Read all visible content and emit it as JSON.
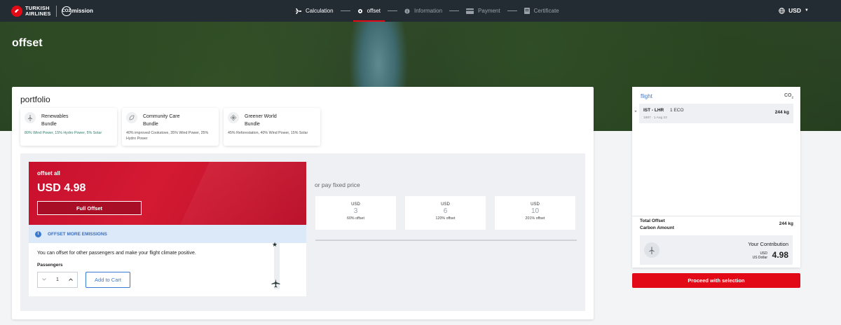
{
  "header": {
    "brand": "TURKISH AIRLINES",
    "brand_line1": "TURKISH",
    "brand_line2": "AIRLINES",
    "program_badge": "CO2",
    "program": "mission",
    "steps": [
      {
        "label": "Calculation",
        "icon": "plane-icon",
        "state": "done"
      },
      {
        "label": "offset",
        "icon": "gear-icon",
        "state": "active"
      },
      {
        "label": "Information",
        "icon": "info-icon",
        "state": "pending"
      },
      {
        "label": "Payment",
        "icon": "card-icon",
        "state": "pending"
      },
      {
        "label": "Certificate",
        "icon": "certificate-icon",
        "state": "pending"
      }
    ],
    "currency": "USD"
  },
  "hero": {
    "title": "offset"
  },
  "portfolio": {
    "title": "portfolio",
    "bundles": [
      {
        "name_line1": "Renewables",
        "name_line2": "Bundle",
        "description": "80% Wind Power, 15% Hydro Power, 5% Solar",
        "selected": true
      },
      {
        "name_line1": "Community Care",
        "name_line2": "Bundle",
        "description": "40% improved Cookstove, 35% Wind Power, 25% Hydro Power",
        "selected": false
      },
      {
        "name_line1": "Greener World",
        "name_line2": "Bundle",
        "description": "45% Reforestation, 40% Wind Power, 15% Solar",
        "selected": false
      }
    ]
  },
  "offset": {
    "label": "offset all",
    "price": "USD 4.98",
    "full_button": "Full Offset",
    "more_title": "OFFSET MORE EMISSIONS",
    "more_text": "You can offset for other passengers and make your flight climate positive.",
    "passengers_label": "Passengers",
    "passengers_value": "1",
    "add_to_cart": "Add to Cart"
  },
  "fixed": {
    "title": "or pay fixed price",
    "options": [
      {
        "currency": "USD",
        "amount": "3",
        "percent": "60% offset"
      },
      {
        "currency": "USD",
        "amount": "6",
        "percent": "120% offset"
      },
      {
        "currency": "USD",
        "amount": "10",
        "percent": "201% offset"
      }
    ]
  },
  "summary": {
    "flight_label": "flight",
    "co2_label": "CO",
    "co2_sub": "2",
    "remove_icon": "×",
    "route": "IST - LHR",
    "cabin": "1 ECO",
    "meta": "1987 · 1 Aug 22",
    "flight_kg": "244 kg",
    "total_line1": "Total Offset",
    "total_line2": "Carbon Amount",
    "total_kg": "244 kg",
    "contribution_label": "Your Contribution",
    "contribution_cur": "USD",
    "contribution_cur_long": "US Dollar",
    "contribution_amount": "4.98"
  },
  "proceed_button": "Proceed with selection",
  "colors": {
    "brand_red": "#e30a17",
    "accent_blue": "#3a7ad3",
    "header_bg": "#232b33"
  }
}
